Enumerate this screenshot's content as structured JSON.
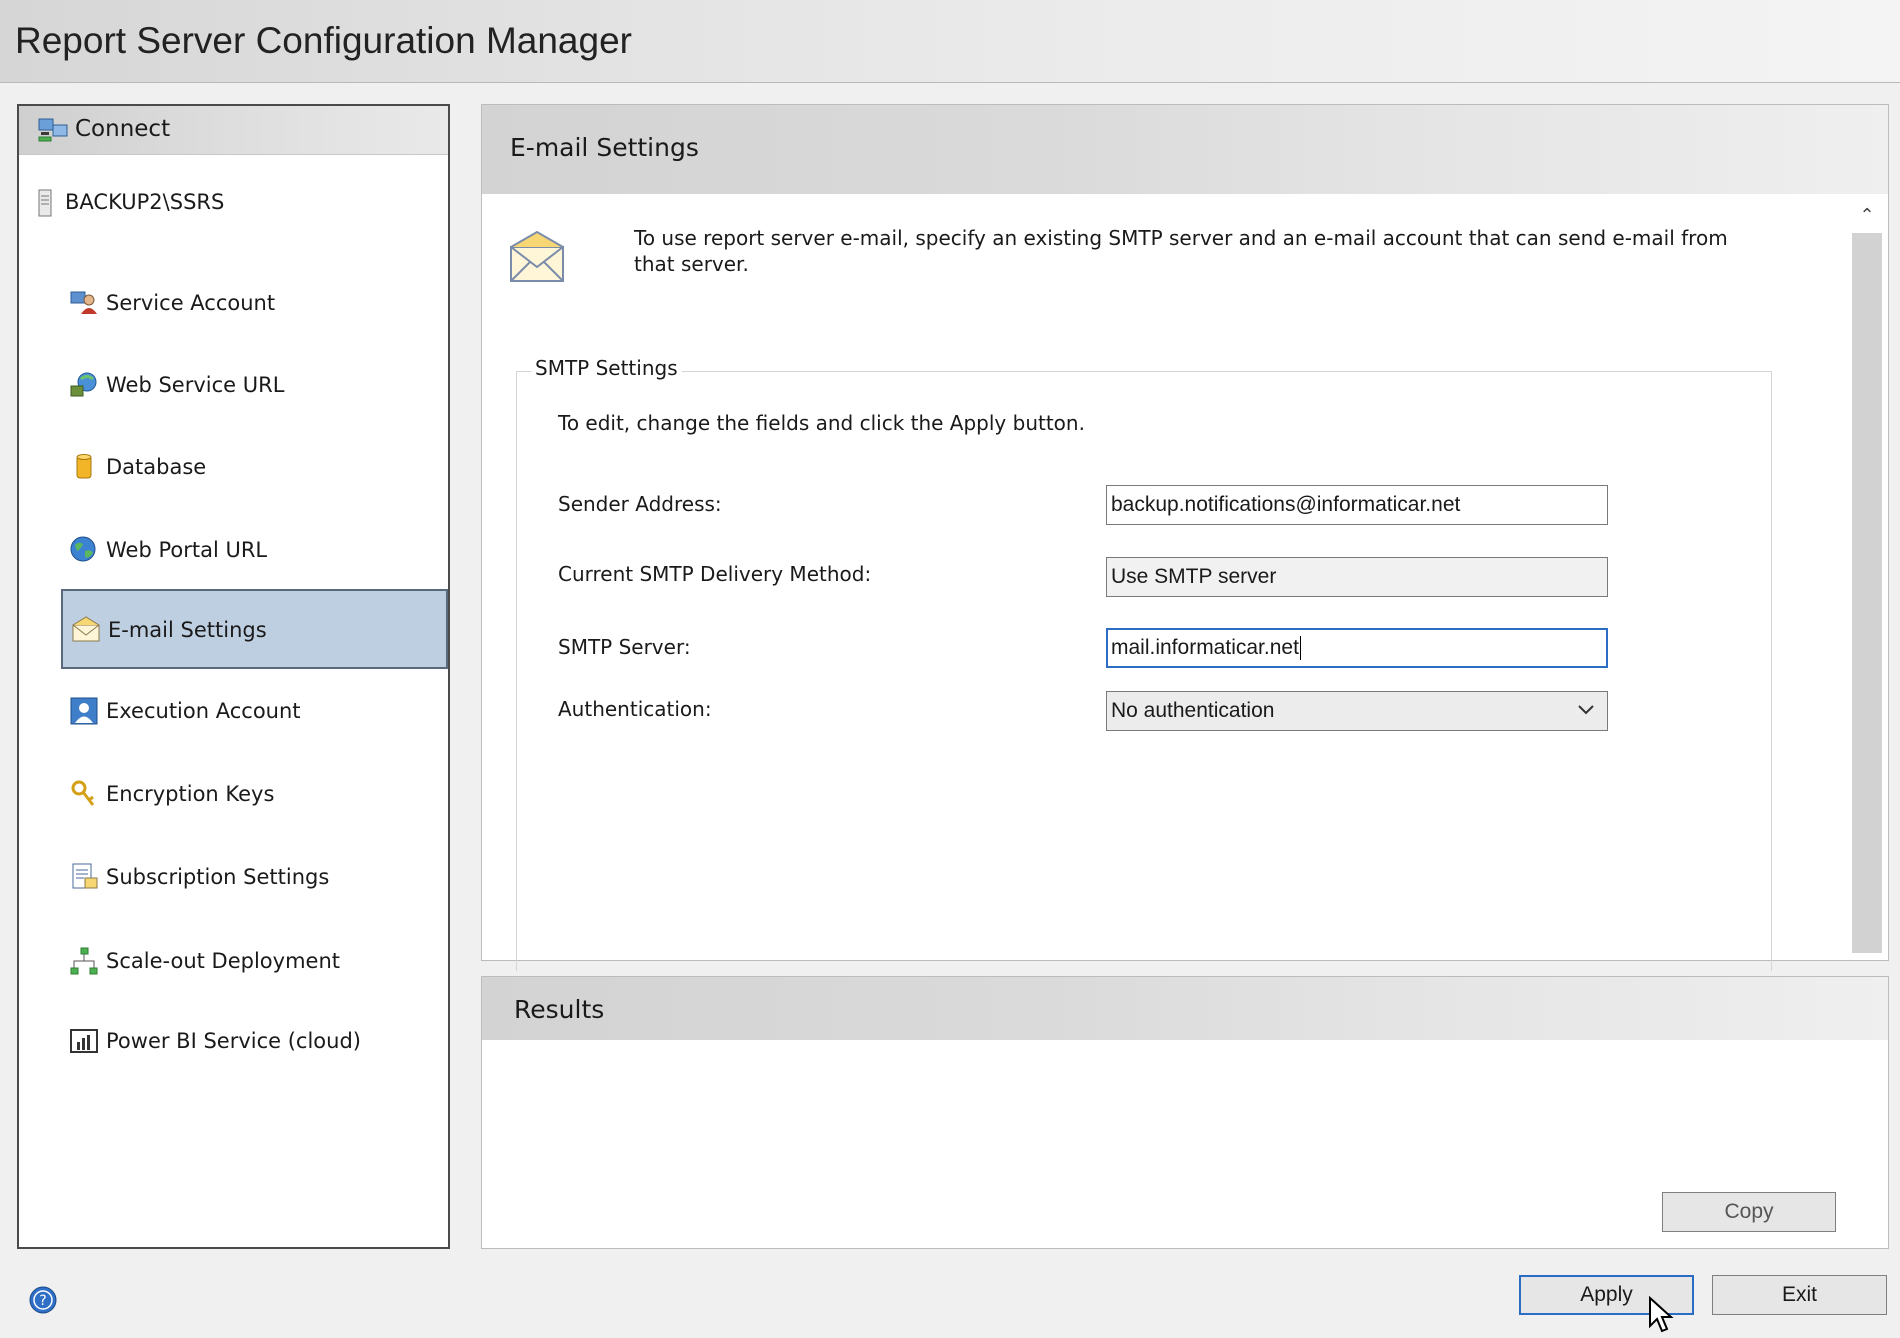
{
  "window": {
    "title": "Report Server Configuration Manager"
  },
  "sidebar": {
    "connect_label": "Connect",
    "server_label": "BACKUP2\\SSRS",
    "items": [
      {
        "label": "Service Account",
        "icon": "service-account-icon"
      },
      {
        "label": "Web Service URL",
        "icon": "web-service-url-icon"
      },
      {
        "label": "Database",
        "icon": "database-icon"
      },
      {
        "label": "Web Portal URL",
        "icon": "globe-icon"
      },
      {
        "label": "E-mail Settings",
        "icon": "envelope-icon",
        "selected": true
      },
      {
        "label": "Execution Account",
        "icon": "user-icon"
      },
      {
        "label": "Encryption Keys",
        "icon": "keys-icon"
      },
      {
        "label": "Subscription Settings",
        "icon": "subscription-icon"
      },
      {
        "label": "Scale-out Deployment",
        "icon": "network-icon"
      },
      {
        "label": "Power BI Service (cloud)",
        "icon": "power-bi-icon"
      }
    ]
  },
  "main": {
    "header": "E-mail Settings",
    "description": "To use report server e-mail, specify an existing SMTP server and an e-mail account that can send e-mail from that server.",
    "group_title": "SMTP Settings",
    "hint": "To edit, change the fields and click the Apply button.",
    "fields": {
      "sender_label": "Sender Address:",
      "sender_value": "backup.notifications@informaticar.net",
      "delivery_label": "Current SMTP Delivery Method:",
      "delivery_value": "Use SMTP server",
      "server_label": "SMTP Server:",
      "server_value": "mail.informaticar.net",
      "auth_label": "Authentication:",
      "auth_value": "No authentication"
    }
  },
  "results": {
    "header": "Results",
    "copy_label": "Copy"
  },
  "footer": {
    "apply_label": "Apply",
    "exit_label": "Exit"
  },
  "colors": {
    "selected_bg": "#bfcfe2",
    "focus_border": "#2b6cc4"
  }
}
